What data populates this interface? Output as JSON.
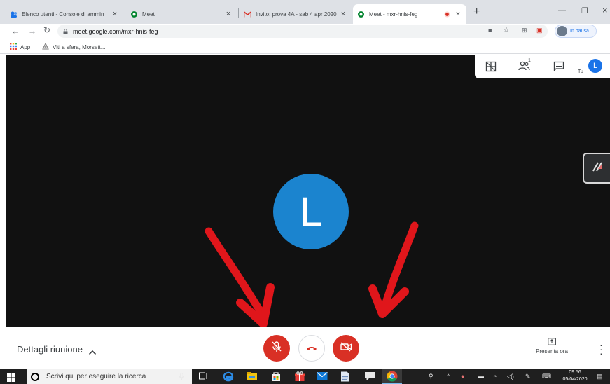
{
  "browser": {
    "tabs": [
      {
        "title": "Elenco utenti - Console di ammin",
        "active": false
      },
      {
        "title": "Meet",
        "active": false
      },
      {
        "title": "Invito: prova 4A - sab 4 apr 2020",
        "active": false
      },
      {
        "title": "Meet - mxr-hnis-feg",
        "active": true
      }
    ],
    "url": "meet.google.com/mxr-hnis-feg",
    "profile_status": "In pausa",
    "bookmarks": [
      {
        "label": "App"
      },
      {
        "label": "Viti a sfera, Morsett..."
      }
    ]
  },
  "meet": {
    "self_label": "Tu",
    "self_initial": "L",
    "participant_initial": "L",
    "participants_badge": "1",
    "meeting_details_label": "Dettagli riunione",
    "present_label": "Presenta ora"
  },
  "taskbar": {
    "search_placeholder": "Scrivi qui per eseguire la ricerca",
    "time": "09:56",
    "date": "05/04/2020"
  },
  "colors": {
    "accent_blue": "#1a73e8",
    "avatar_blue": "#1b84cf",
    "danger_red": "#d93025",
    "stage_black": "#111111",
    "arrow_red": "#e0161b"
  }
}
